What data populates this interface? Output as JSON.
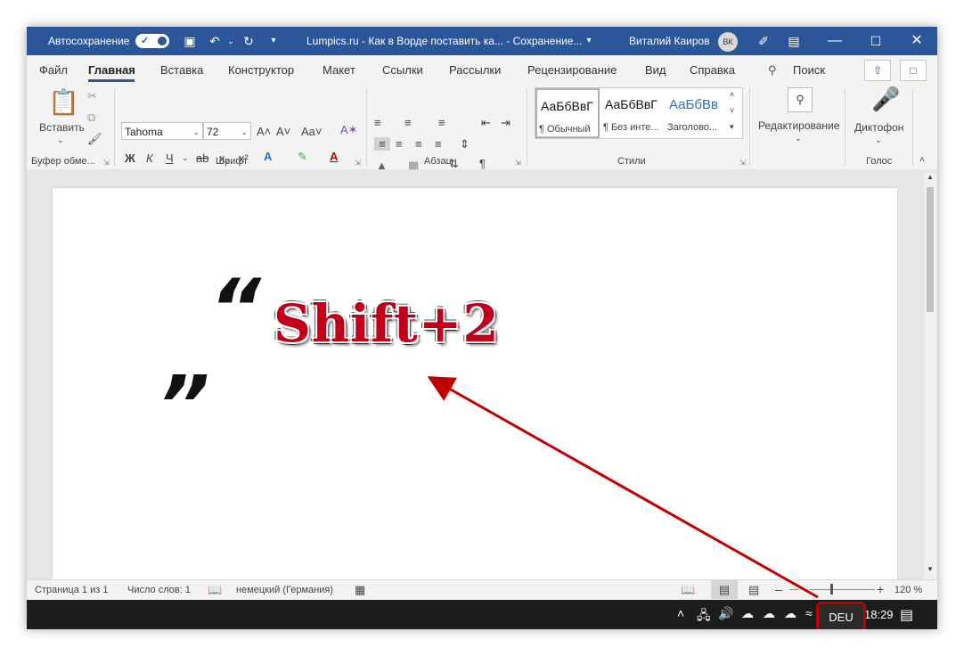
{
  "titlebar": {
    "autosave_label": "Автосохранение",
    "doc_title": "Lumpics.ru - Как в Ворде поставить ка...  -  Сохранение...",
    "user_name": "Виталий Каиров",
    "avatar_initials": "ВК"
  },
  "tabs": [
    "Файл",
    "Главная",
    "Вставка",
    "Конструктор",
    "Макет",
    "Ссылки",
    "Рассылки",
    "Рецензирование",
    "Вид",
    "Справка"
  ],
  "search_label": "Поиск",
  "ribbon": {
    "clipboard": {
      "paste_label": "Вставить",
      "group_label": "Буфер обме..."
    },
    "font": {
      "font_name": "Tahoma",
      "font_size": "72",
      "case_label": "Aa",
      "group_label": "Шрифт",
      "bold": "Ж",
      "italic": "К",
      "underline": "Ч"
    },
    "paragraph": {
      "group_label": "Абзац"
    },
    "styles": {
      "group_label": "Стили",
      "items": [
        {
          "preview": "АаБбВвГ",
          "name": "¶ Обычный"
        },
        {
          "preview": "АаБбВвГ",
          "name": "¶ Без инте..."
        },
        {
          "preview": "АаБбВв",
          "name": "Заголово..."
        }
      ]
    },
    "editing": {
      "label": "Редактирование"
    },
    "voice": {
      "dictation_label": "Диктофон",
      "group_label": "Голос"
    }
  },
  "document": {
    "quote_left": "„",
    "quote_right": "“",
    "overlay_text": "Shift+2"
  },
  "statusbar": {
    "page": "Страница 1 из 1",
    "words": "Число слов: 1",
    "language": "немецкий (Германия)",
    "zoom": "120 %"
  },
  "taskbar": {
    "keyboard_layout": "DEU",
    "time": "18:29"
  },
  "colors": {
    "title_bar": "#2b579a",
    "highlight": "#c00000"
  }
}
